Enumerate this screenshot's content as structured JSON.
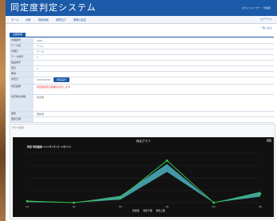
{
  "app": {
    "title": "同定度判定システム",
    "user": "ログインユーザー：管理者"
  },
  "menu": {
    "items": [
      "ホーム",
      "台帳",
      "検索画面",
      "帳票出力",
      "権限の設定"
    ],
    "right": "ログアウト"
  },
  "subbar": {
    "link": "一覧へ戻る"
  },
  "section": {
    "title": "台帳情報"
  },
  "form": {
    "rows": [
      {
        "label": "管理番号",
        "value": "0001"
      },
      {
        "label": "データ名",
        "value": "テスト"
      },
      {
        "label": "管理元",
        "value": "データ"
      },
      {
        "label": "データ番号",
        "value": "1"
      },
      {
        "label": "製品番号",
        "value": ""
      },
      {
        "label": "型式",
        "value": "1"
      },
      {
        "label": "備考",
        "value": ""
      },
      {
        "label": "判定日",
        "value": "2023/01/05",
        "button": "判定実行"
      },
      {
        "label": "判定結果",
        "value": "同定度判定の結果を表示します"
      },
      {
        "label": "判定時の詳細",
        "value": "判定値"
      },
      {
        "label": "更新",
        "value": "更新者"
      },
      {
        "label": "更新日時",
        "value": ""
      }
    ]
  },
  "chart_panel": {
    "header": "グラフ表示"
  },
  "chart_data": {
    "type": "area",
    "title": "判定グラフ",
    "info_label": "判定 判定結果",
    "info_text": "2023年1月5日 10時15分",
    "categories": [
      "1回",
      "2回",
      "3回",
      "4回",
      "5回",
      "6回"
    ],
    "ylim": [
      0,
      100
    ],
    "series": [
      {
        "name": "判定値",
        "values": [
          3,
          0,
          10,
          85,
          0,
          18
        ]
      },
      {
        "name": "判定下限",
        "values": [
          1,
          0,
          6,
          62,
          0,
          12
        ]
      },
      {
        "name": "判定上限",
        "values": [
          4,
          0,
          14,
          78,
          0,
          22
        ]
      }
    ],
    "legend": [
      "判定値",
      "判定下限",
      "判定上限"
    ],
    "colors": {
      "band_fill": "#4aa8b8",
      "line": "#35c44b",
      "marker": "#2fcf3b",
      "grid": "#2a2a2a"
    }
  }
}
